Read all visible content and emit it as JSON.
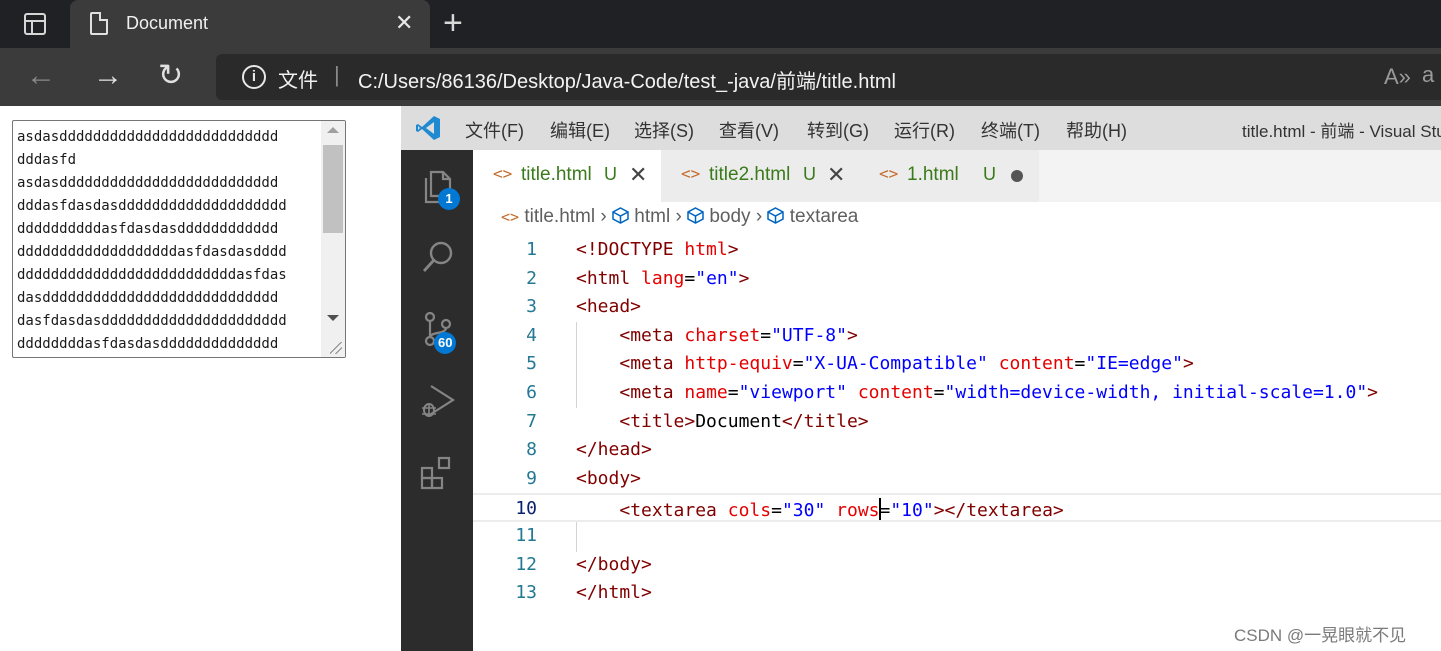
{
  "browser": {
    "tab_title": "Document",
    "address_label": "文件",
    "address_url": "C:/Users/86136/Desktop/Java-Code/test_-java/前端/title.html"
  },
  "page": {
    "textarea_content": "asdasdddddddddddddddddddddddddd\ndddasfd\nasdasdddddddddddddddddddddddddd\ndddasfdasdasdddddddddddddddddddd\nddddddddddasfdasdasdddddddddddd\ndddddddddddddddddddasfdasdasdddd\nddddddddddddddddddddddddddasfdas\ndasdddddddddddddddddddddddddddd\ndasfdasdasdddddddddddddddddddddd\nddddddddasfdasdasdddddddddddddd"
  },
  "vscode": {
    "menu": [
      "文件(F)",
      "编辑(E)",
      "选择(S)",
      "查看(V)",
      "转到(G)",
      "运行(R)",
      "终端(T)",
      "帮助(H)"
    ],
    "window_title": "title.html - 前端 - Visual Studio Code",
    "badges": {
      "explorer": "1",
      "source_control": "60"
    },
    "tabs": [
      {
        "icon": "<>",
        "name": "title.html",
        "status": "U"
      },
      {
        "icon": "<>",
        "name": "title2.html",
        "status": "U"
      },
      {
        "icon": "<>",
        "name": "1.html",
        "status": "U"
      }
    ],
    "breadcrumbs": {
      "file": "title.html",
      "path": [
        "html",
        "body",
        "textarea"
      ]
    },
    "current_line": 10,
    "lines": [
      {
        "n": "1",
        "tokens": [
          [
            "t-tag",
            "<!DOCTYPE "
          ],
          [
            "t-attr",
            "html"
          ],
          [
            "t-tag",
            ">"
          ]
        ]
      },
      {
        "n": "2",
        "tokens": [
          [
            "t-tag",
            "<html "
          ],
          [
            "t-attr",
            "lang"
          ],
          [
            "t-txt",
            "="
          ],
          [
            "t-val",
            "\"en\""
          ],
          [
            "t-tag",
            ">"
          ]
        ]
      },
      {
        "n": "3",
        "tokens": [
          [
            "t-tag",
            "<head>"
          ]
        ]
      },
      {
        "n": "4",
        "tokens": [
          [
            "t-txt",
            "    "
          ],
          [
            "t-tag",
            "<meta "
          ],
          [
            "t-attr",
            "charset"
          ],
          [
            "t-txt",
            "="
          ],
          [
            "t-val",
            "\"UTF-8\""
          ],
          [
            "t-tag",
            ">"
          ]
        ]
      },
      {
        "n": "5",
        "tokens": [
          [
            "t-txt",
            "    "
          ],
          [
            "t-tag",
            "<meta "
          ],
          [
            "t-attr",
            "http-equiv"
          ],
          [
            "t-txt",
            "="
          ],
          [
            "t-val",
            "\"X-UA-Compatible\""
          ],
          [
            "t-txt",
            " "
          ],
          [
            "t-attr",
            "content"
          ],
          [
            "t-txt",
            "="
          ],
          [
            "t-val",
            "\"IE=edge\""
          ],
          [
            "t-tag",
            ">"
          ]
        ]
      },
      {
        "n": "6",
        "tokens": [
          [
            "t-txt",
            "    "
          ],
          [
            "t-tag",
            "<meta "
          ],
          [
            "t-attr",
            "name"
          ],
          [
            "t-txt",
            "="
          ],
          [
            "t-val",
            "\"viewport\""
          ],
          [
            "t-txt",
            " "
          ],
          [
            "t-attr",
            "content"
          ],
          [
            "t-txt",
            "="
          ],
          [
            "t-val",
            "\"width=device-width, initial-scale=1.0\""
          ],
          [
            "t-tag",
            ">"
          ]
        ]
      },
      {
        "n": "7",
        "tokens": [
          [
            "t-txt",
            "    "
          ],
          [
            "t-tag",
            "<title>"
          ],
          [
            "t-txt",
            "Document"
          ],
          [
            "t-tag",
            "</title>"
          ]
        ]
      },
      {
        "n": "8",
        "tokens": [
          [
            "t-tag",
            "</head>"
          ]
        ]
      },
      {
        "n": "9",
        "tokens": [
          [
            "t-tag",
            "<body>"
          ]
        ]
      },
      {
        "n": "10",
        "tokens": [
          [
            "t-txt",
            "    "
          ],
          [
            "t-tag",
            "<textarea "
          ],
          [
            "t-attr",
            "cols"
          ],
          [
            "t-txt",
            "="
          ],
          [
            "t-val",
            "\"30\""
          ],
          [
            "t-txt",
            " "
          ],
          [
            "t-attr",
            "rows"
          ],
          [
            "cursor",
            ""
          ],
          [
            "t-txt",
            "="
          ],
          [
            "t-val",
            "\"10\""
          ],
          [
            "t-tag",
            "></textarea>"
          ]
        ]
      },
      {
        "n": "11",
        "tokens": []
      },
      {
        "n": "12",
        "tokens": [
          [
            "t-tag",
            "</body>"
          ]
        ]
      },
      {
        "n": "13",
        "tokens": [
          [
            "t-tag",
            "</html>"
          ]
        ]
      }
    ]
  },
  "watermark": "CSDN @一晃眼就不见",
  "colors": {
    "accent": "#0078d4",
    "tag": "#800000",
    "attr": "#e50000",
    "value": "#0000ff",
    "line_number": "#237893"
  }
}
